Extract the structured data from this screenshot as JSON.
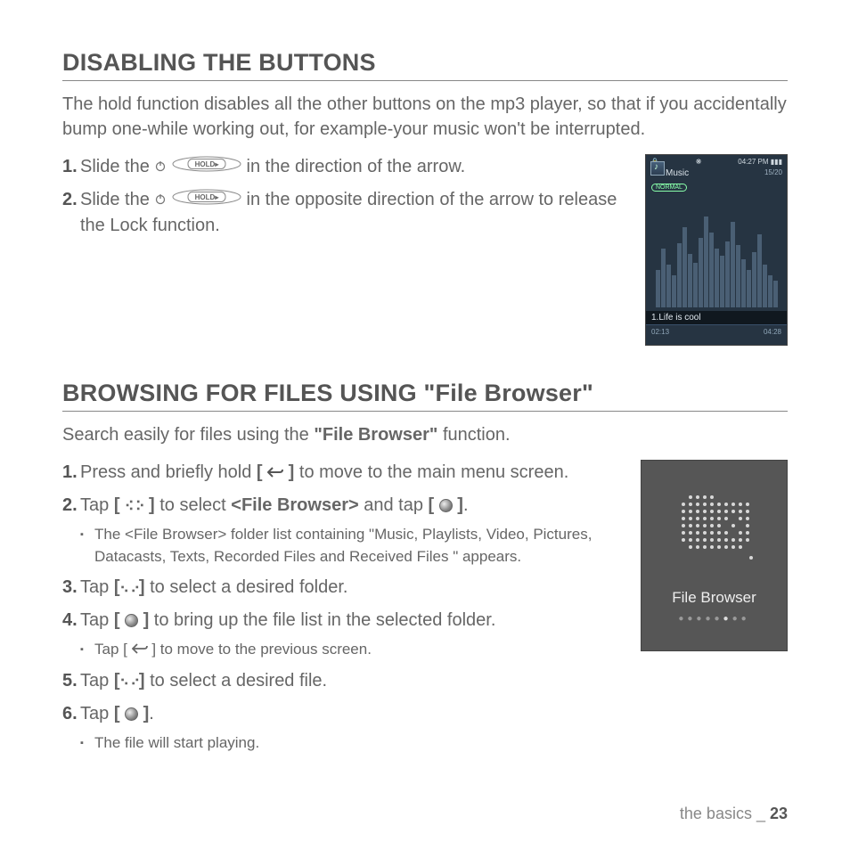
{
  "section1": {
    "heading": "DISABLING THE BUTTONS",
    "intro": "The hold function disables all the other buttons on the mp3 player, so that if you accidentally bump one-while working out, for example-your music won't be interrupted.",
    "steps": [
      {
        "num": "1.",
        "pre": "Slide the ",
        "post": " in the direction of the arrow."
      },
      {
        "num": "2.",
        "pre": "Slide the ",
        "post": " in the opposite direction of the arrow to release the Lock function."
      }
    ],
    "hold_label": "HOLD▸",
    "device": {
      "time": "04:27 PM",
      "title": "Music",
      "track_index": "15/20",
      "mode": "NORMAL",
      "song": "1.Life is cool",
      "elapsed": "02:13",
      "total": "04:28"
    }
  },
  "section2": {
    "heading": "BROWSING FOR FILES USING \"File Browser\"",
    "intro_pre": "Search easily for files using the ",
    "intro_bold": "\"File Browser\"",
    "intro_post": " function.",
    "steps": {
      "s1": {
        "num": "1.",
        "pre": "Press and briefly hold ",
        "post": " to move to the main menu screen."
      },
      "s2": {
        "num": "2.",
        "pre": "Tap ",
        "mid": " to select ",
        "bold": "<File Browser>",
        "mid2": " and tap ",
        "end": ".",
        "sub": "The <File Browser> folder list containing \"Music, Playlists, Video, Pictures, Datacasts, Texts, Recorded Files and Received Files \" appears."
      },
      "s3": {
        "num": "3.",
        "pre": "Tap ",
        "post": " to select a desired folder."
      },
      "s4": {
        "num": "4.",
        "pre": "Tap ",
        "post": " to bring up the file list in the selected folder.",
        "sub": "Tap [ ",
        "sub_post": " ] to move to the previous screen."
      },
      "s5": {
        "num": "5.",
        "pre": "Tap ",
        "post": " to select a desired file."
      },
      "s6": {
        "num": "6.",
        "pre": " Tap ",
        "post": ".",
        "sub": "The file will start playing."
      }
    },
    "device": {
      "label": "File Browser"
    }
  },
  "footer": {
    "section": "the basics",
    "sep": " _ ",
    "page": "23"
  }
}
